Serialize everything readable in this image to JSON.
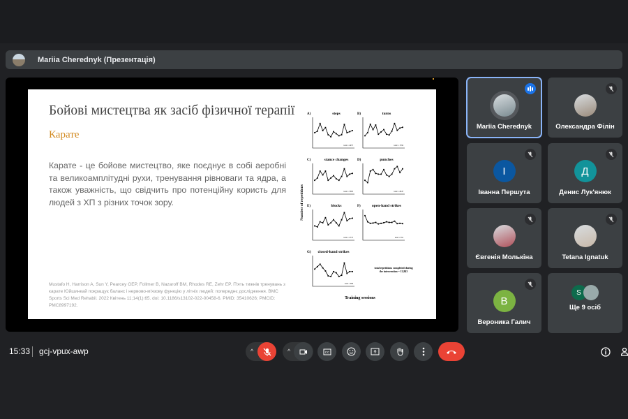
{
  "presenter_bar": {
    "label": "Mariia Cherednyk (Презентація)"
  },
  "slide": {
    "title": "Бойові мистецтва як засіб фізичної терапії",
    "subtitle": "Карате",
    "body": "Карате - це бойове мистецтво, яке поєднує в собі аеробні та великоамплітудні рухи, тренування рівноваги та ядра, а також уважність, що свідчить про потенційну користь для людей з ХП з різних точок зору.",
    "citation": "Mustafo H, Harrison A, Sun Y, Pearcey GEP, Follmer B, Nazaroff BM, Rhodes RE, Zehr EP. П'ять тижнів тренувань з карате Юйшинкай покращує баланс і нервово-м'язову функцію у літніх людей: попереднє дослідження. BMC Sports Sci Med Rehabil. 2022 Квітень 11;14(1):65. doi: 10.1186/s13102-022-00458-6. PMID: 35410626; PMCID: PMC8997192.",
    "figure": {
      "ylabel": "Number of repetitions",
      "xlabel": "Training sessions",
      "note": "total repetitions completed during the intervention = 13,843",
      "panels": [
        {
          "label": "A)",
          "title": "steps",
          "ymax": 3000,
          "total": "total = 2457",
          "values": [
            1500,
            1650,
            2400,
            1700,
            2000,
            1300,
            1100,
            1600,
            1400,
            1200,
            1300,
            2300,
            1500,
            1600,
            1700
          ]
        },
        {
          "label": "B)",
          "title": "turns",
          "ymax": 2000,
          "total": "total = 1792",
          "values": [
            800,
            1000,
            1550,
            1200,
            1500,
            900,
            1050,
            1200,
            900,
            850,
            1100,
            1600,
            1150,
            1300,
            1350
          ]
        },
        {
          "label": "C)",
          "title": "stance changes",
          "ymax": 4000,
          "total": "total = 3565",
          "values": [
            1800,
            2100,
            3000,
            2500,
            3000,
            1800,
            2100,
            2400,
            2000,
            1800,
            2300,
            3300,
            2300,
            2600,
            2700
          ]
        },
        {
          "label": "D)",
          "title": "punches",
          "ymax": 2000,
          "total": "total = 2047",
          "values": [
            900,
            750,
            1500,
            1600,
            1350,
            1300,
            1300,
            1600,
            1250,
            1150,
            1300,
            1650,
            1800,
            1400,
            1650
          ]
        },
        {
          "label": "E)",
          "title": "blocks",
          "ymax": 3000,
          "total": "total = 2737",
          "values": [
            1400,
            1300,
            1800,
            1700,
            2200,
            1500,
            1700,
            2000,
            1700,
            1400,
            2000,
            2700,
            1900,
            2100,
            2150
          ]
        },
        {
          "label": "F)",
          "title": "open-hand strikes",
          "ymax": 1000,
          "total": "total = 591",
          "values": [
            800,
            600,
            550,
            560,
            580,
            530,
            550,
            570,
            600,
            580,
            580,
            620,
            540,
            550,
            540
          ]
        },
        {
          "label": "G)",
          "title": "closed-hand strikes",
          "ymax": 50,
          "total": "total = 369",
          "values": [
            28,
            32,
            36,
            30,
            25,
            17,
            16,
            24,
            22,
            16,
            18,
            38,
            21,
            24,
            24
          ]
        }
      ]
    }
  },
  "participants": [
    {
      "name": "Mariia Cherednyk",
      "type": "photo",
      "speaking": true,
      "color": "#7a8a90"
    },
    {
      "name": "Олександра Філін",
      "type": "photo",
      "muted": true,
      "color": "#9a8a7a"
    },
    {
      "name": "Іванна Першута",
      "initial": "І",
      "muted": true,
      "color": "#0b57a0"
    },
    {
      "name": "Денис Лук'янюк",
      "initial": "Д",
      "muted": true,
      "color": "#12939a"
    },
    {
      "name": "Євгенія Молькіна",
      "type": "photo",
      "muted": true,
      "color": "#b0505a"
    },
    {
      "name": "Tetana Ignatuk",
      "type": "photo",
      "muted": true,
      "color": "#c8b8a8"
    },
    {
      "name": "Вероника Галич",
      "initial": "В",
      "muted": true,
      "color": "#7cb342"
    },
    {
      "name": "Ще 9 осіб",
      "initial": "S",
      "color": "#0d6b4c"
    }
  ],
  "bottom_bar": {
    "time": "15:33",
    "meeting_code": "gcj-vpux-awp"
  }
}
